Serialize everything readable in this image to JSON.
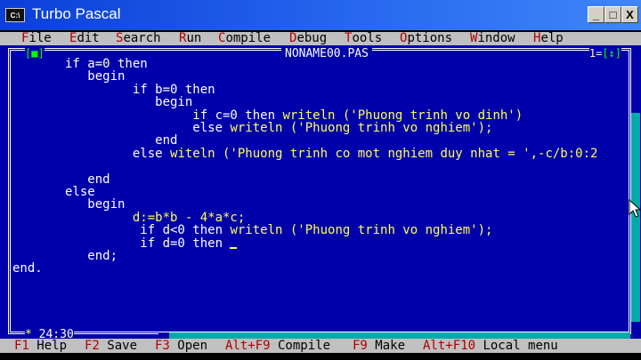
{
  "window": {
    "title": "Turbo Pascal",
    "icon_text": "C:\\"
  },
  "window_buttons": {
    "minimize": "_",
    "maximize": "□",
    "close": "X"
  },
  "menu": {
    "file": {
      "hot": "F",
      "rest": "ile"
    },
    "edit": {
      "hot": "E",
      "rest": "dit"
    },
    "search": {
      "hot": "S",
      "rest": "earch"
    },
    "run": {
      "hot": "R",
      "rest": "un"
    },
    "compile": {
      "hot": "C",
      "rest": "ompile"
    },
    "debug": {
      "hot": "D",
      "rest": "ebug"
    },
    "tools": {
      "hot": "T",
      "rest": "ools"
    },
    "options": {
      "hot": "O",
      "rest": "ptions"
    },
    "window": {
      "hot": "W",
      "rest": "indow"
    },
    "help": {
      "hot": "H",
      "rest": "elp"
    }
  },
  "editor": {
    "filename": "NONAME00.PAS",
    "close_box": "[■]",
    "window_number": "1",
    "zoom_box": "[↕]",
    "cursor_position": "24:30",
    "lines": [
      {
        "pre": "       if a=0 then",
        "hl": ""
      },
      {
        "pre": "          begin",
        "hl": ""
      },
      {
        "pre": "                if b=0 then",
        "hl": ""
      },
      {
        "pre": "                   begin",
        "hl": ""
      },
      {
        "pre": "                        if c=0 then ",
        "hl": "writeln ('Phuong trinh vo dinh')"
      },
      {
        "pre": "                        else ",
        "hl": "writeln ('Phuong trinh vo nghiem');"
      },
      {
        "pre": "                   end",
        "hl": ""
      },
      {
        "pre": "                else ",
        "hl": "witeln ('Phuong trinh co mot nghiem duy nhat = ',-c/b:0:2"
      },
      {
        "pre": "",
        "hl": ""
      },
      {
        "pre": "          end",
        "hl": ""
      },
      {
        "pre": "       else",
        "hl": ""
      },
      {
        "pre": "          begin",
        "hl": ""
      },
      {
        "pre": "                ",
        "hl": "d:=b*b - 4*a*c;"
      },
      {
        "pre": "                 if d<0 then ",
        "hl": "writeln ('Phuong trinh vo nghiem');"
      },
      {
        "pre": "                 if d=0 then ",
        "hl": ""
      },
      {
        "pre": "          end;",
        "hl": ""
      },
      {
        "pre": "end.",
        "hl": ""
      }
    ]
  },
  "status": {
    "f1": {
      "key": "F1",
      "label": " Help"
    },
    "f2": {
      "key": "F2",
      "label": " Save"
    },
    "f3": {
      "key": "F3",
      "label": " Open"
    },
    "af9": {
      "key": "Alt+F9",
      "label": " Compile"
    },
    "f9": {
      "key": "F9",
      "label": " Make"
    },
    "af10": {
      "key": "Alt+F10",
      "label": " Local menu"
    }
  }
}
